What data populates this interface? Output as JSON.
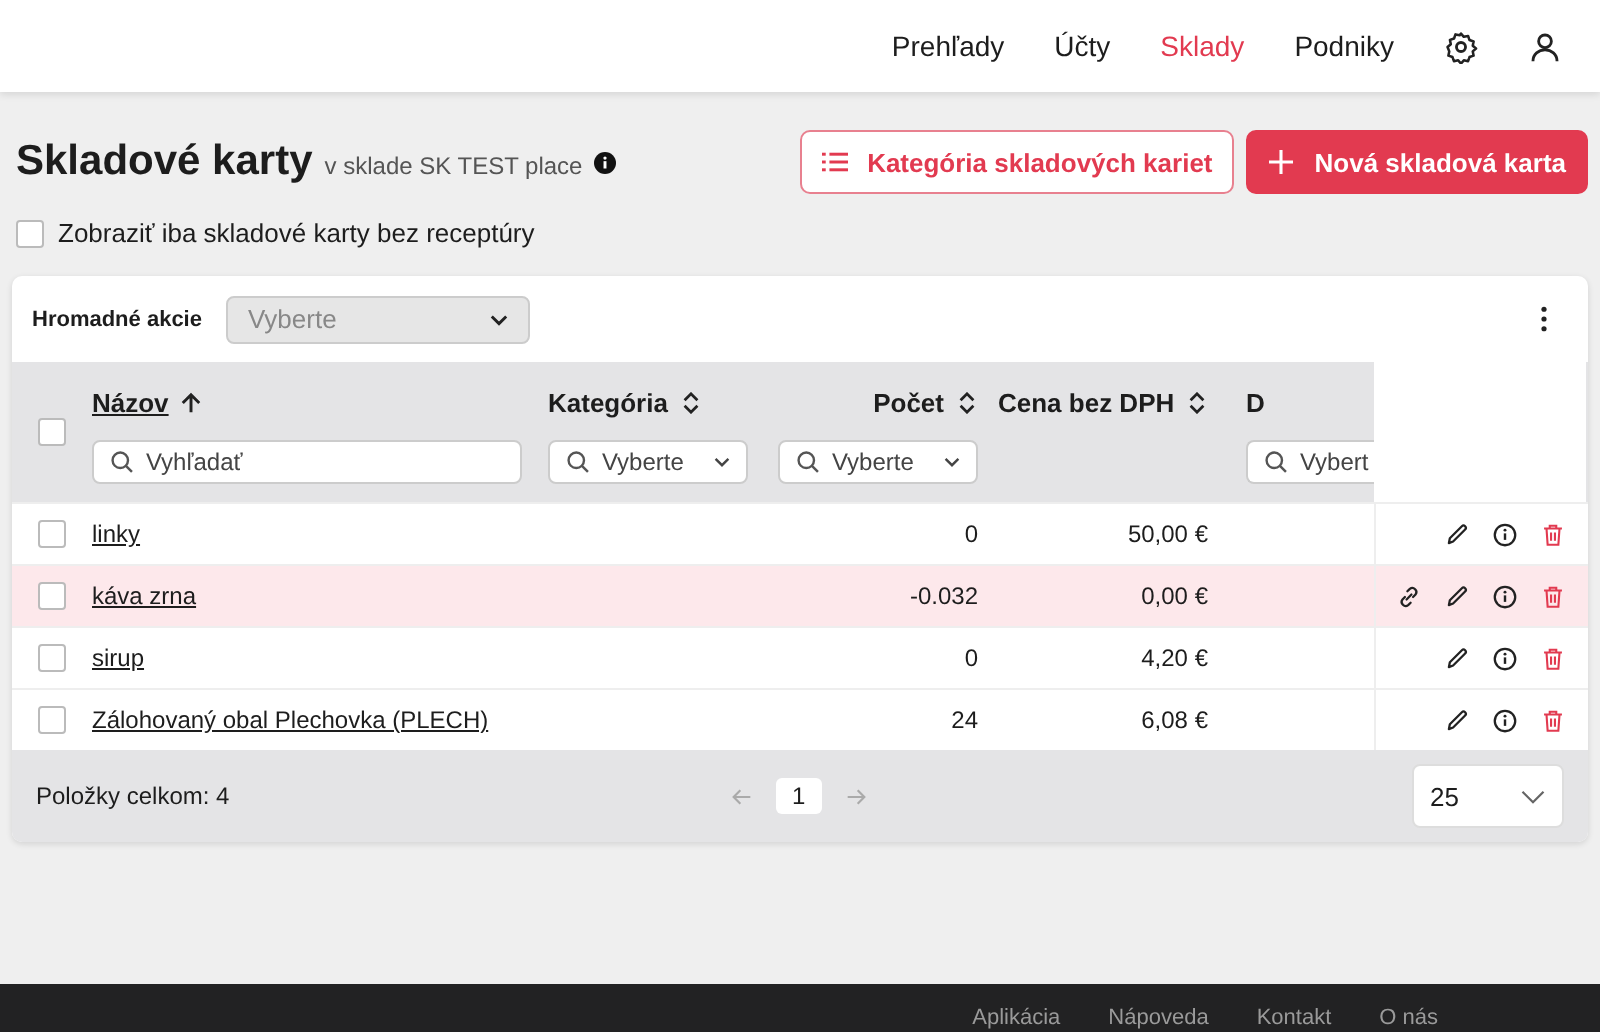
{
  "nav": {
    "items": [
      {
        "label": "Prehľady",
        "selected": false
      },
      {
        "label": "Účty",
        "selected": false
      },
      {
        "label": "Sklady",
        "selected": true
      },
      {
        "label": "Podniky",
        "selected": false
      }
    ]
  },
  "page": {
    "title": "Skladové karty",
    "subtitle": "v sklade SK TEST place",
    "buttons": [
      {
        "label": "Kategória skladových kariet",
        "kind": "outline"
      },
      {
        "label": "Nová skladová karta",
        "kind": "primary"
      }
    ],
    "filter_checkbox": {
      "label": "Zobraziť iba skladové karty bez receptúry",
      "checked": false
    }
  },
  "toolbar": {
    "label": "Hromadné akcie",
    "select": {
      "placeholder": "Vyberte",
      "disabled": true
    }
  },
  "table": {
    "select_all_checked": false,
    "columns": [
      {
        "label": "Názov",
        "sorted": true,
        "filter": {
          "kind": "search",
          "placeholder": "Vyhľadať"
        }
      },
      {
        "label": "Kategória",
        "sorted": false,
        "filter": {
          "kind": "select",
          "placeholder": "Vyberte"
        }
      },
      {
        "label": "Počet",
        "sorted": false,
        "filter": {
          "kind": "select",
          "placeholder": "Vyberte"
        }
      },
      {
        "label": "Cena bez DPH",
        "sorted": false
      },
      {
        "label": "D",
        "filter": {
          "kind": "select",
          "placeholder": "Vybert"
        }
      }
    ],
    "rows": [
      {
        "name": "linky",
        "count": "0",
        "price": "50,00 €",
        "warning": false,
        "linked": false,
        "checked": false
      },
      {
        "name": "káva zrna",
        "count": "-0.032",
        "price": "0,00 €",
        "warning": true,
        "linked": true,
        "checked": false
      },
      {
        "name": "sirup",
        "count": "0",
        "price": "4,20 €",
        "warning": false,
        "linked": false,
        "checked": false
      },
      {
        "name": "Zálohovaný obal Plechovka (PLECH)",
        "count": "24",
        "price": "6,08 €",
        "warning": false,
        "linked": false,
        "checked": false
      }
    ],
    "total": "Položky celkom: 4",
    "pages": [
      {
        "label": "1",
        "selected": true
      }
    ],
    "page_size": "25"
  },
  "footer": {
    "links": [
      "Aplikácia",
      "Nápoveda",
      "Kontakt",
      "O nás"
    ]
  }
}
